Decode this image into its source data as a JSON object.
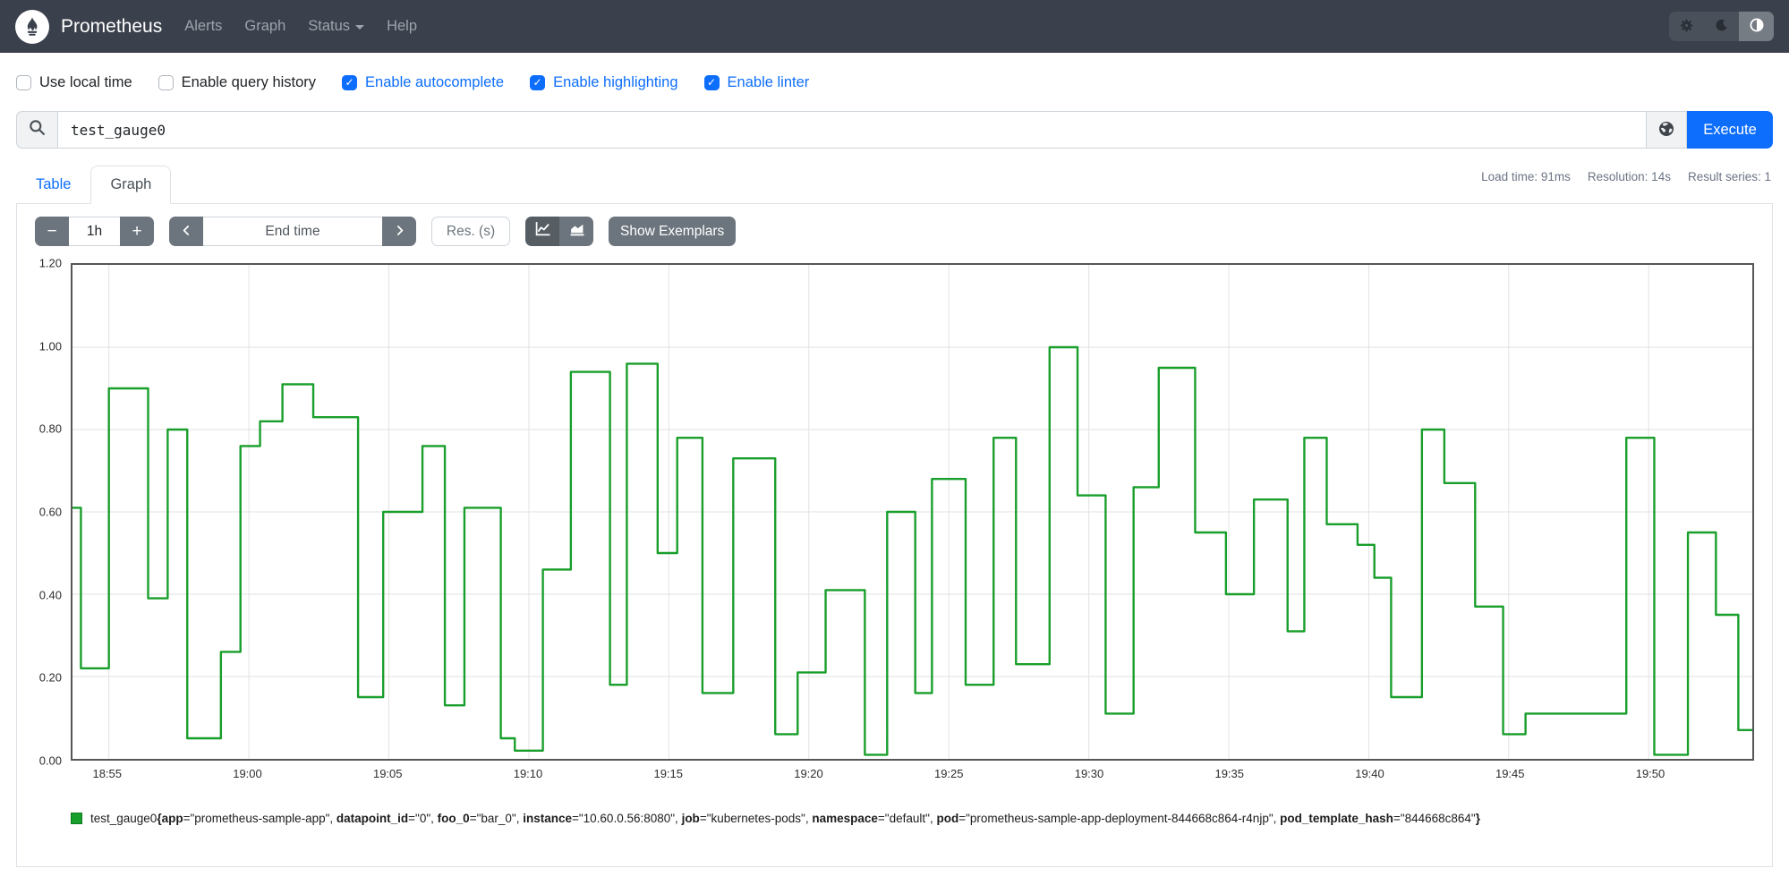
{
  "navbar": {
    "brand": "Prometheus",
    "links": [
      {
        "label": "Alerts"
      },
      {
        "label": "Graph"
      },
      {
        "label": "Status",
        "has_caret": true
      },
      {
        "label": "Help"
      }
    ],
    "theme_toggle": {
      "options": [
        "light",
        "dark",
        "auto"
      ],
      "active": "auto"
    }
  },
  "icons": {
    "logo": "prometheus-flame",
    "theme_light": "gear",
    "theme_dark": "moon-crescent",
    "theme_auto": "half-filled-circle",
    "query_prefix": "magnifier",
    "explorer": "globe",
    "decrease": "minus",
    "increase": "plus",
    "back": "chevron-left",
    "forward": "chevron-right",
    "line_chart": "line-chart",
    "stacked_chart": "stacked-area-chart",
    "checked": "checkmark"
  },
  "options_bar": {
    "checkboxes": [
      {
        "label": "Use local time",
        "checked": false
      },
      {
        "label": "Enable query history",
        "checked": false
      },
      {
        "label": "Enable autocomplete",
        "checked": true
      },
      {
        "label": "Enable highlighting",
        "checked": true
      },
      {
        "label": "Enable linter",
        "checked": true
      }
    ]
  },
  "query_bar": {
    "value": "test_gauge0",
    "execute_label": "Execute"
  },
  "tabs": [
    {
      "label": "Table",
      "active": false
    },
    {
      "label": "Graph",
      "active": true
    }
  ],
  "stats": {
    "load_time": "Load time: 91ms",
    "resolution": "Resolution: 14s",
    "result_series": "Result series: 1"
  },
  "graph_controls": {
    "range": "1h",
    "minus_label": "−",
    "plus_label": "+",
    "end_time_placeholder": "End time",
    "res_placeholder": "Res. (s)",
    "show_exemplars": "Show Exemplars"
  },
  "chart_data": {
    "type": "line",
    "step": true,
    "title": "",
    "xlabel": "",
    "ylabel": "",
    "ylim": [
      0,
      1.2
    ],
    "x_max": 60,
    "grid": true,
    "legend_position": "bottom",
    "y_ticks": [
      {
        "value": 0.0,
        "label": "0.00"
      },
      {
        "value": 0.2,
        "label": "0.20"
      },
      {
        "value": 0.4,
        "label": "0.40"
      },
      {
        "value": 0.6,
        "label": "0.60"
      },
      {
        "value": 0.8,
        "label": "0.80"
      },
      {
        "value": 1.0,
        "label": "1.00"
      },
      {
        "value": 1.2,
        "label": "1.20"
      }
    ],
    "y_gridlines": [
      0.2,
      0.4,
      0.6,
      0.8,
      1.0
    ],
    "x_ticks": [
      {
        "t": 1.3,
        "label": "18:55"
      },
      {
        "t": 6.3,
        "label": "19:00"
      },
      {
        "t": 11.3,
        "label": "19:05"
      },
      {
        "t": 16.3,
        "label": "19:10"
      },
      {
        "t": 21.3,
        "label": "19:15"
      },
      {
        "t": 26.3,
        "label": "19:20"
      },
      {
        "t": 31.3,
        "label": "19:25"
      },
      {
        "t": 36.3,
        "label": "19:30"
      },
      {
        "t": 41.3,
        "label": "19:35"
      },
      {
        "t": 46.3,
        "label": "19:40"
      },
      {
        "t": 51.3,
        "label": "19:45"
      },
      {
        "t": 56.3,
        "label": "19:50"
      }
    ],
    "series": [
      {
        "name": "test_gauge0",
        "color": "#189e2a",
        "points": [
          [
            0,
            0.61
          ],
          [
            0.3,
            0.22
          ],
          [
            1.3,
            0.9
          ],
          [
            2.7,
            0.39
          ],
          [
            3.4,
            0.8
          ],
          [
            4.1,
            0.05
          ],
          [
            5.3,
            0.26
          ],
          [
            6.0,
            0.76
          ],
          [
            6.7,
            0.82
          ],
          [
            7.5,
            0.91
          ],
          [
            8.6,
            0.83
          ],
          [
            10.2,
            0.15
          ],
          [
            11.1,
            0.6
          ],
          [
            12.5,
            0.76
          ],
          [
            13.3,
            0.13
          ],
          [
            14.0,
            0.61
          ],
          [
            15.3,
            0.05
          ],
          [
            15.8,
            0.02
          ],
          [
            16.8,
            0.46
          ],
          [
            17.8,
            0.94
          ],
          [
            19.2,
            0.18
          ],
          [
            19.8,
            0.96
          ],
          [
            20.9,
            0.5
          ],
          [
            21.6,
            0.78
          ],
          [
            22.5,
            0.16
          ],
          [
            23.6,
            0.73
          ],
          [
            25.1,
            0.06
          ],
          [
            25.9,
            0.21
          ],
          [
            26.9,
            0.41
          ],
          [
            28.3,
            0.01
          ],
          [
            29.1,
            0.6
          ],
          [
            30.1,
            0.16
          ],
          [
            30.7,
            0.68
          ],
          [
            31.9,
            0.18
          ],
          [
            32.9,
            0.78
          ],
          [
            33.7,
            0.23
          ],
          [
            34.9,
            1.0
          ],
          [
            35.9,
            0.64
          ],
          [
            36.9,
            0.11
          ],
          [
            37.9,
            0.66
          ],
          [
            38.8,
            0.95
          ],
          [
            40.1,
            0.55
          ],
          [
            41.2,
            0.4
          ],
          [
            42.2,
            0.63
          ],
          [
            43.4,
            0.31
          ],
          [
            44.0,
            0.78
          ],
          [
            44.8,
            0.57
          ],
          [
            45.9,
            0.52
          ],
          [
            46.5,
            0.44
          ],
          [
            47.1,
            0.15
          ],
          [
            48.2,
            0.8
          ],
          [
            49.0,
            0.67
          ],
          [
            50.1,
            0.37
          ],
          [
            51.1,
            0.06
          ],
          [
            51.9,
            0.11
          ],
          [
            55.5,
            0.78
          ],
          [
            56.5,
            0.01
          ],
          [
            57.7,
            0.55
          ],
          [
            58.7,
            0.35
          ],
          [
            59.5,
            0.07
          ],
          [
            60,
            0.07
          ]
        ]
      }
    ]
  },
  "legend": {
    "metric": "test_gauge0",
    "labels": [
      {
        "name": "app",
        "value": "prometheus-sample-app"
      },
      {
        "name": "datapoint_id",
        "value": "0"
      },
      {
        "name": "foo_0",
        "value": "bar_0"
      },
      {
        "name": "instance",
        "value": "10.60.0.56:8080"
      },
      {
        "name": "job",
        "value": "kubernetes-pods"
      },
      {
        "name": "namespace",
        "value": "default"
      },
      {
        "name": "pod",
        "value": "prometheus-sample-app-deployment-844668c864-r4njp"
      },
      {
        "name": "pod_template_hash",
        "value": "844668c864"
      }
    ]
  },
  "colors": {
    "navbar_bg": "#3b414c",
    "accent_blue": "#0d6efd",
    "button_gray": "#6c757d",
    "series_green": "#189e2a",
    "grid": "#e2e2e2",
    "chart_border": "#565656"
  }
}
